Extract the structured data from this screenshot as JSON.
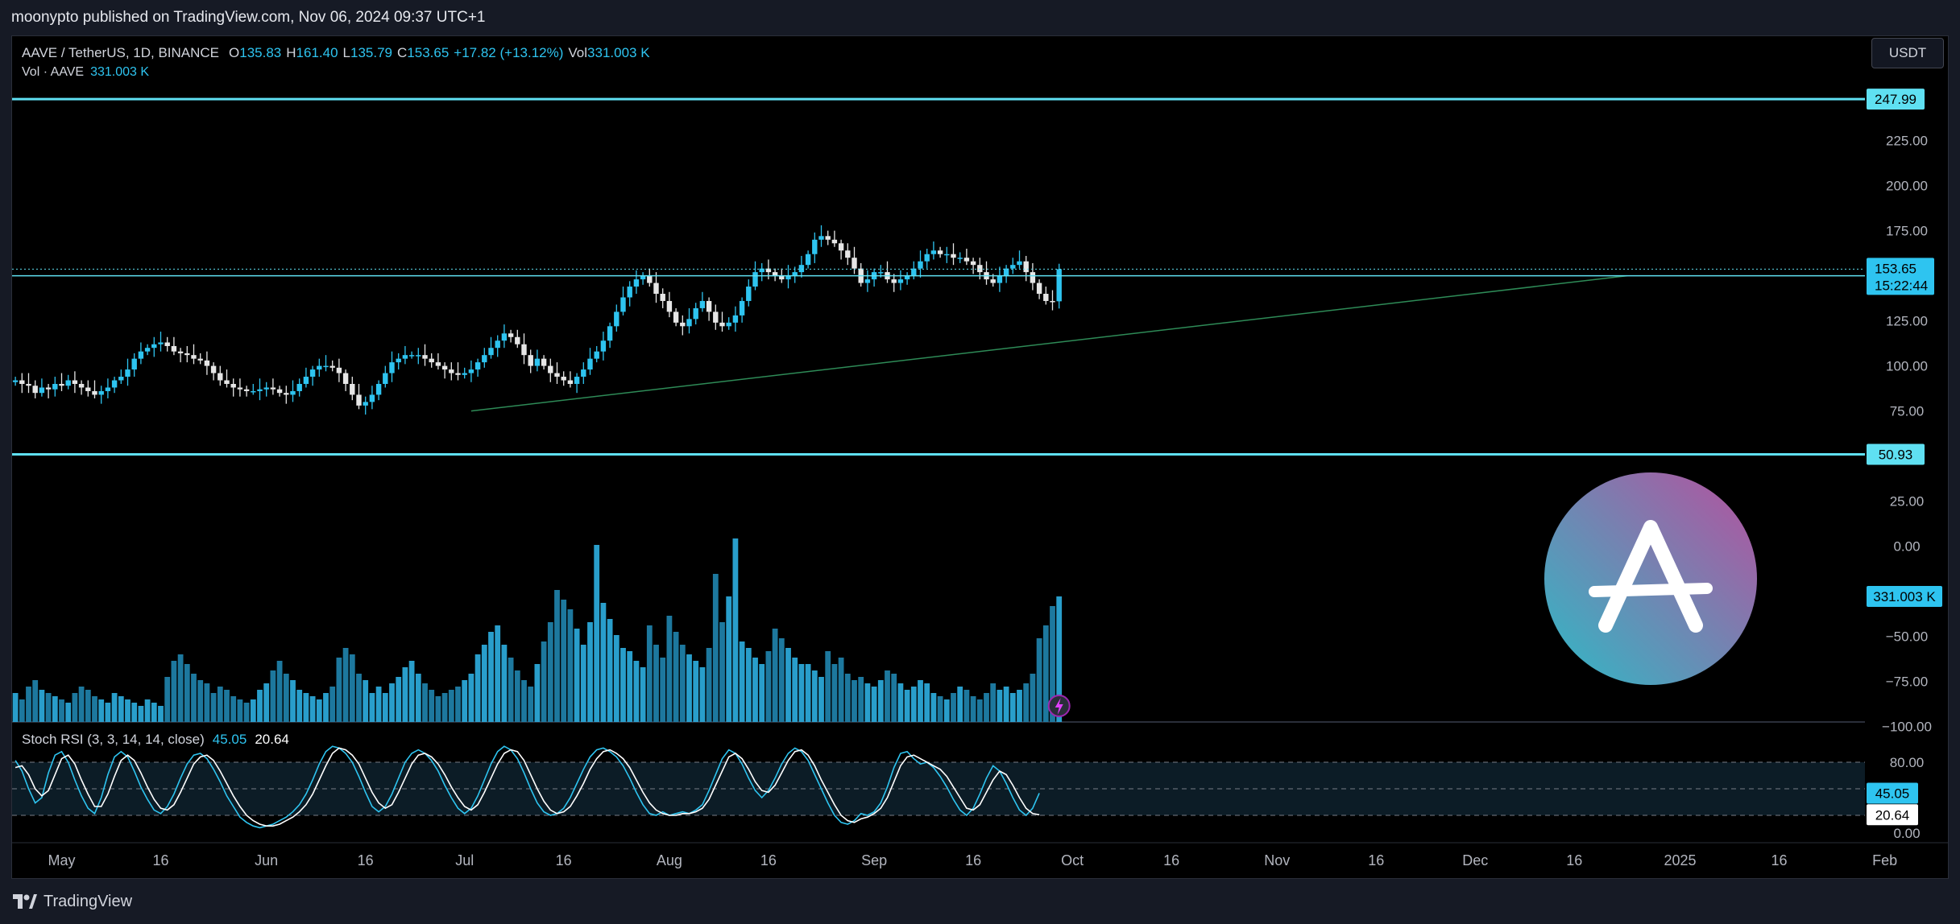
{
  "header": {
    "publish_line": "moonypto published on TradingView.com, Nov 06, 2024 09:37 UTC+1"
  },
  "footer": {
    "brand": "TradingView"
  },
  "currency_button": "USDT",
  "legend": {
    "symbol": "AAVE / TetherUS, 1D, BINANCE",
    "o_label": "O",
    "o_value": "135.83",
    "h_label": "H",
    "h_value": "161.40",
    "l_label": "L",
    "l_value": "135.79",
    "c_label": "C",
    "c_value": "153.65",
    "change": "+17.82 (+13.12%)",
    "vol_label": "Vol",
    "vol_value": "331.003 K",
    "vol_row_label": "Vol · AAVE",
    "vol_row_value": "331.003 K"
  },
  "stoch_legend": {
    "title": "Stoch RSI (3, 3, 14, 14, close)",
    "k_value": "45.05",
    "d_value": "20.64"
  },
  "colors": {
    "up": "#2ec4f0",
    "down": "#e6e6e6",
    "level_line": "#5fe0f2",
    "trendline": "#2e8b57",
    "background": "#000000"
  },
  "chart_data": [
    {
      "type": "candlestick",
      "ylim": [
        -110,
        265
      ],
      "y_ticks": [
        "225.00",
        "200.00",
        "175.00",
        "150.00",
        "125.00",
        "100.00",
        "75.00",
        "50.00",
        "25.00",
        "0.00",
        "−25.00",
        "−50.00",
        "−75.00",
        "−100.00"
      ],
      "x_ticks": [
        "May",
        "16",
        "Jun",
        "16",
        "Jul",
        "16",
        "Aug",
        "16",
        "Sep",
        "16",
        "Oct",
        "16",
        "Nov",
        "16",
        "Dec",
        "16",
        "2025",
        "16",
        "Feb"
      ],
      "levels": [
        {
          "value": 247.99,
          "label": "247.99"
        },
        {
          "value": 50.93,
          "label": "50.93"
        },
        {
          "value": 149.98,
          "label": "149.98"
        }
      ],
      "price_badge": {
        "value": 153.65,
        "label": "153.65",
        "countdown": "15:22:44"
      },
      "trendline": {
        "from": [
          "2024-07-02",
          75
        ],
        "to": [
          "2024-12-24",
          150
        ]
      },
      "x_start": "2024-04-24",
      "closes": [
        92,
        90,
        89,
        85,
        88,
        87,
        90,
        89,
        92,
        90,
        88,
        86,
        84,
        86,
        88,
        92,
        94,
        98,
        104,
        108,
        110,
        112,
        113,
        111,
        108,
        107,
        106,
        104,
        103,
        100,
        96,
        92,
        90,
        88,
        87,
        86,
        86,
        87,
        88,
        87,
        85,
        84,
        86,
        90,
        94,
        98,
        100,
        100,
        99,
        96,
        90,
        84,
        78,
        80,
        84,
        90,
        96,
        102,
        104,
        106,
        106,
        106,
        104,
        102,
        100,
        98,
        96,
        95,
        96,
        98,
        102,
        106,
        110,
        114,
        118,
        116,
        112,
        106,
        100,
        104,
        100,
        96,
        94,
        92,
        90,
        94,
        98,
        104,
        108,
        114,
        122,
        130,
        138,
        144,
        148,
        150,
        146,
        140,
        136,
        130,
        124,
        122,
        126,
        132,
        136,
        130,
        124,
        122,
        124,
        128,
        136,
        144,
        152,
        154,
        152,
        150,
        148,
        150,
        152,
        156,
        162,
        170,
        172,
        170,
        168,
        164,
        160,
        154,
        146,
        148,
        152,
        152,
        148,
        146,
        148,
        150,
        154,
        158,
        162,
        164,
        162,
        162,
        160,
        160,
        158,
        156,
        152,
        148,
        146,
        150,
        154,
        156,
        158,
        152,
        146,
        140,
        136,
        135.83,
        153.65
      ],
      "volume": {
        "value_label": "331.003 K",
        "bars": [
          18,
          14,
          22,
          26,
          20,
          18,
          16,
          14,
          12,
          18,
          22,
          20,
          16,
          14,
          12,
          18,
          16,
          14,
          12,
          10,
          14,
          12,
          10,
          28,
          38,
          42,
          36,
          30,
          26,
          24,
          18,
          22,
          20,
          16,
          14,
          12,
          14,
          20,
          24,
          32,
          38,
          30,
          26,
          20,
          18,
          16,
          14,
          18,
          22,
          40,
          46,
          42,
          30,
          26,
          18,
          22,
          18,
          24,
          28,
          34,
          38,
          30,
          24,
          20,
          16,
          18,
          20,
          22,
          26,
          30,
          42,
          48,
          56,
          60,
          48,
          40,
          32,
          26,
          22,
          36,
          50,
          62,
          82,
          76,
          70,
          58,
          48,
          62,
          110,
          74,
          64,
          54,
          46,
          44,
          38,
          34,
          60,
          48,
          40,
          66,
          56,
          48,
          42,
          38,
          34,
          46,
          92,
          62,
          78,
          114,
          50,
          46,
          40,
          36,
          44,
          58,
          52,
          46,
          40,
          36,
          36,
          32,
          28,
          44,
          36,
          40,
          30,
          26,
          28,
          24,
          22,
          26,
          32,
          30,
          24,
          20,
          22,
          26,
          24,
          18,
          16,
          14,
          18,
          22,
          20,
          16,
          14,
          18,
          24,
          20,
          22,
          18,
          20,
          24,
          30,
          52,
          60,
          72,
          78
        ]
      }
    },
    {
      "type": "line",
      "title": "Stoch RSI (3, 3, 14, 14, close)",
      "ylim": [
        0,
        100
      ],
      "y_ticks": [
        "80.00",
        "0.00"
      ],
      "bands": [
        80,
        50,
        20
      ],
      "series": [
        {
          "name": "K",
          "values": [
            82,
            70,
            50,
            34,
            40,
            68,
            88,
            92,
            80,
            60,
            42,
            28,
            22,
            40,
            66,
            86,
            92,
            86,
            70,
            52,
            38,
            26,
            22,
            30,
            44,
            62,
            78,
            88,
            90,
            84,
            72,
            58,
            42,
            30,
            18,
            12,
            8,
            6,
            8,
            10,
            14,
            18,
            24,
            32,
            44,
            60,
            78,
            92,
            98,
            96,
            90,
            80,
            64,
            46,
            30,
            24,
            30,
            44,
            62,
            80,
            90,
            94,
            90,
            82,
            70,
            54,
            40,
            28,
            22,
            28,
            42,
            60,
            78,
            92,
            98,
            94,
            84,
            68,
            50,
            34,
            24,
            20,
            22,
            28,
            40,
            56,
            72,
            86,
            94,
            96,
            92,
            86,
            76,
            62,
            46,
            32,
            22,
            20,
            24,
            20,
            22,
            24,
            22,
            26,
            32,
            48,
            66,
            84,
            94,
            90,
            78,
            62,
            48,
            40,
            48,
            62,
            78,
            90,
            96,
            92,
            82,
            66,
            50,
            34,
            20,
            12,
            10,
            14,
            22,
            20,
            24,
            34,
            52,
            74,
            90,
            92,
            84,
            78,
            80,
            74,
            64,
            52,
            38,
            26,
            20,
            28,
            44,
            62,
            76,
            70,
            56,
            40,
            26,
            20,
            28,
            45.05
          ]
        },
        {
          "name": "D",
          "values": [
            74,
            76,
            66,
            50,
            42,
            48,
            66,
            84,
            88,
            78,
            60,
            44,
            30,
            30,
            44,
            64,
            82,
            88,
            82,
            68,
            52,
            38,
            28,
            26,
            32,
            46,
            62,
            78,
            86,
            88,
            82,
            70,
            56,
            42,
            30,
            20,
            14,
            10,
            8,
            8,
            10,
            14,
            18,
            24,
            32,
            44,
            60,
            76,
            90,
            96,
            94,
            88,
            78,
            62,
            46,
            34,
            28,
            32,
            46,
            62,
            78,
            88,
            90,
            86,
            78,
            66,
            52,
            40,
            30,
            26,
            32,
            46,
            62,
            78,
            90,
            94,
            92,
            82,
            66,
            50,
            36,
            26,
            22,
            24,
            30,
            42,
            56,
            72,
            84,
            92,
            94,
            90,
            84,
            74,
            60,
            46,
            34,
            26,
            22,
            20,
            20,
            22,
            22,
            24,
            28,
            38,
            54,
            70,
            86,
            90,
            84,
            72,
            58,
            48,
            46,
            54,
            68,
            82,
            92,
            94,
            88,
            76,
            60,
            46,
            32,
            20,
            14,
            12,
            16,
            18,
            22,
            28,
            40,
            58,
            76,
            86,
            88,
            84,
            80,
            76,
            72,
            64,
            52,
            40,
            28,
            26,
            32,
            46,
            60,
            70,
            66,
            54,
            40,
            28,
            22,
            20.64
          ]
        }
      ]
    }
  ]
}
